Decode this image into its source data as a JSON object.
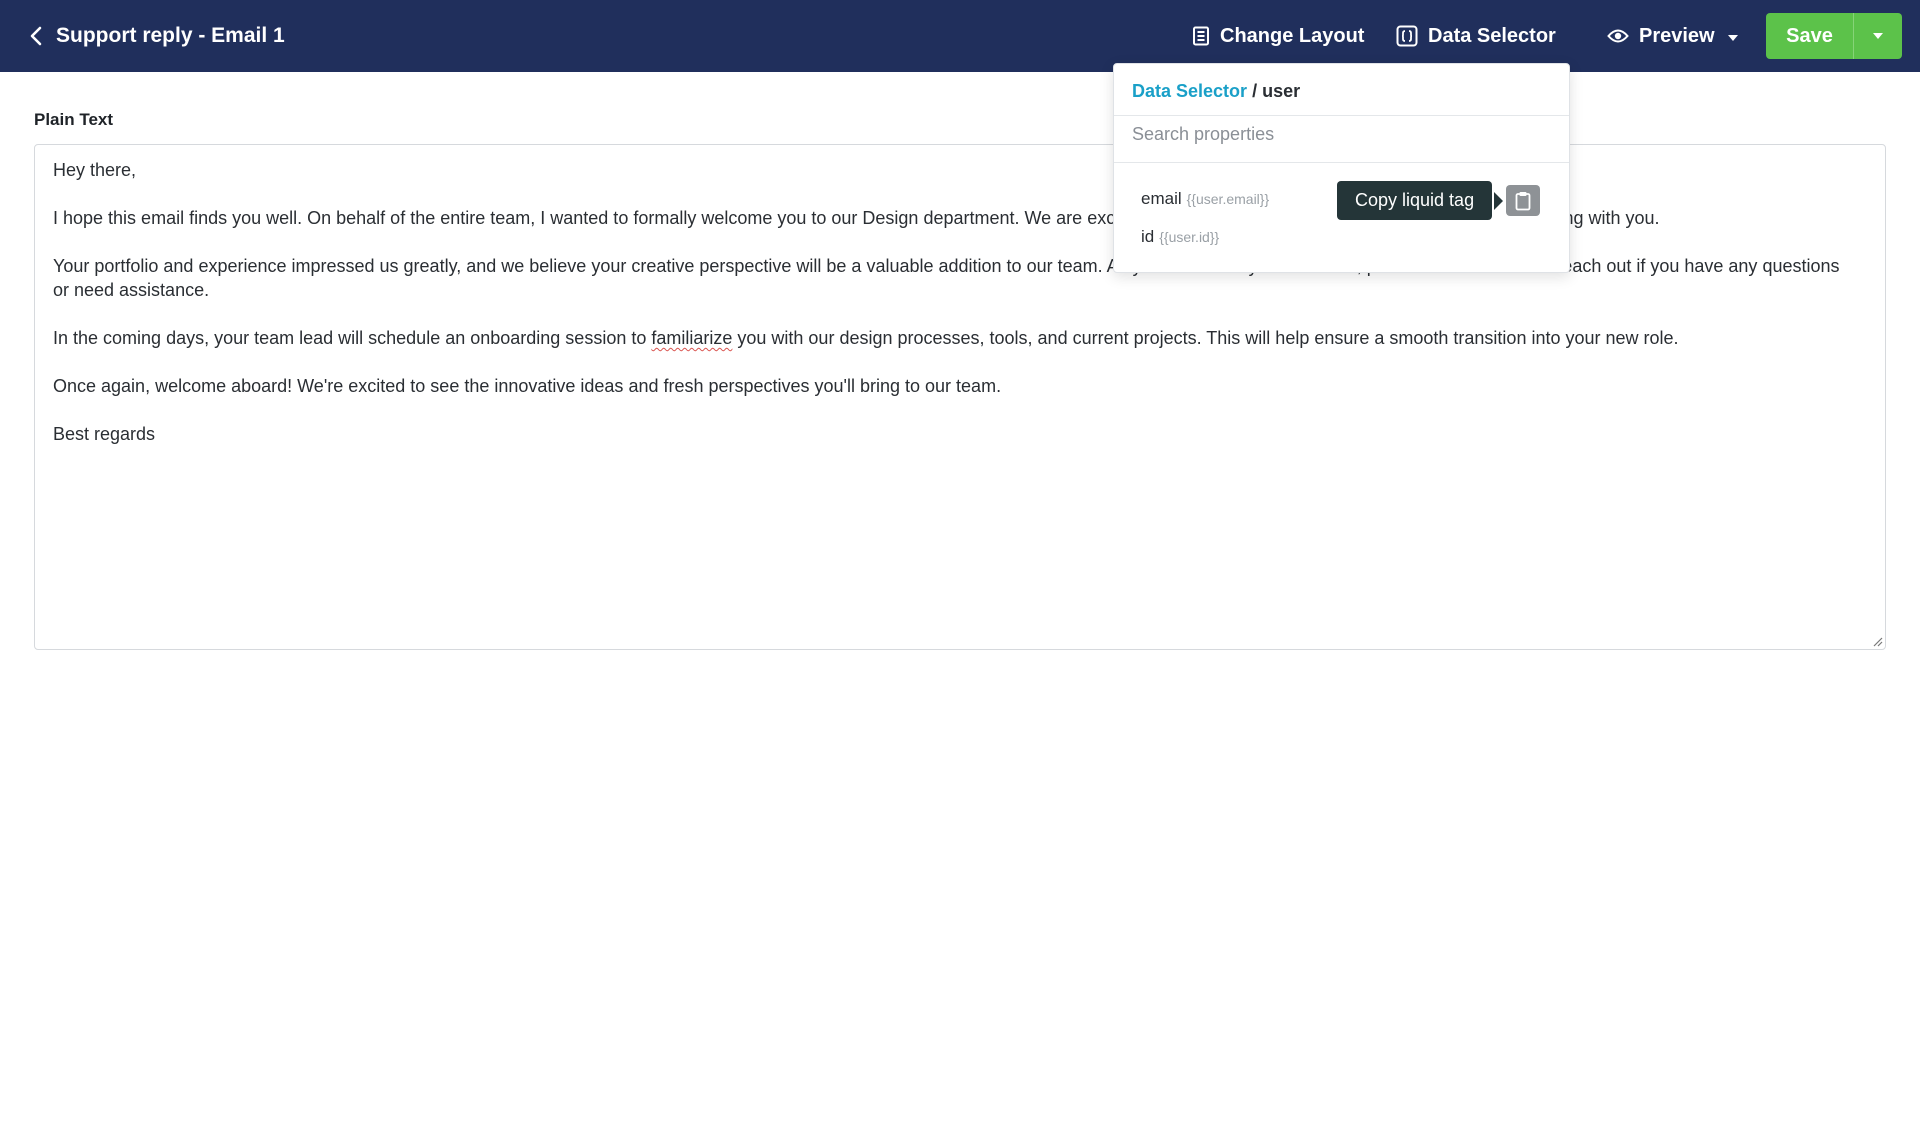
{
  "header": {
    "title": "Support reply - Email 1",
    "change_layout_label": "Change Layout",
    "data_selector_label": "Data Selector",
    "preview_label": "Preview",
    "save_label": "Save",
    "background_color": "#202f5c",
    "save_color": "#5cc24a"
  },
  "editor": {
    "label": "Plain Text",
    "paragraphs": [
      "Hey there,",
      "I hope this email finds you well. On behalf of the entire team, I wanted to formally welcome you to our Design department. We are excited to have you on board and look forward to collaborating with you.",
      "Your portfolio and experience impressed us greatly, and we believe your creative perspective will be a valuable addition to our team. As you settle into your new role, please don't hesitate to reach out if you have any questions or need assistance.",
      {
        "before": "In the coming days, your team lead will schedule an onboarding session to ",
        "misspelled": "familiarize",
        "after": " you with our design processes, tools, and current projects. This will help ensure a smooth transition into your new role."
      },
      "Once again, welcome aboard! We're excited to see the innovative ideas and fresh perspectives you'll bring to our team.",
      "Best regards"
    ]
  },
  "data_selector": {
    "breadcrumb_root": "Data Selector",
    "breadcrumb_separator": " / ",
    "breadcrumb_current": "user",
    "search_placeholder": "Search properties",
    "items": [
      {
        "name": "email",
        "tag": "{{user.email}}"
      },
      {
        "name": "id",
        "tag": "{{user.id}}"
      }
    ],
    "tooltip": "Copy liquid tag",
    "link_color": "#1aa0c8"
  },
  "icons": {
    "back": "chevron-left-icon",
    "change_layout": "layout-icon",
    "data_selector": "braces-icon",
    "preview": "eye-icon",
    "dropdown": "caret-down-icon",
    "copy": "clipboard-icon"
  }
}
